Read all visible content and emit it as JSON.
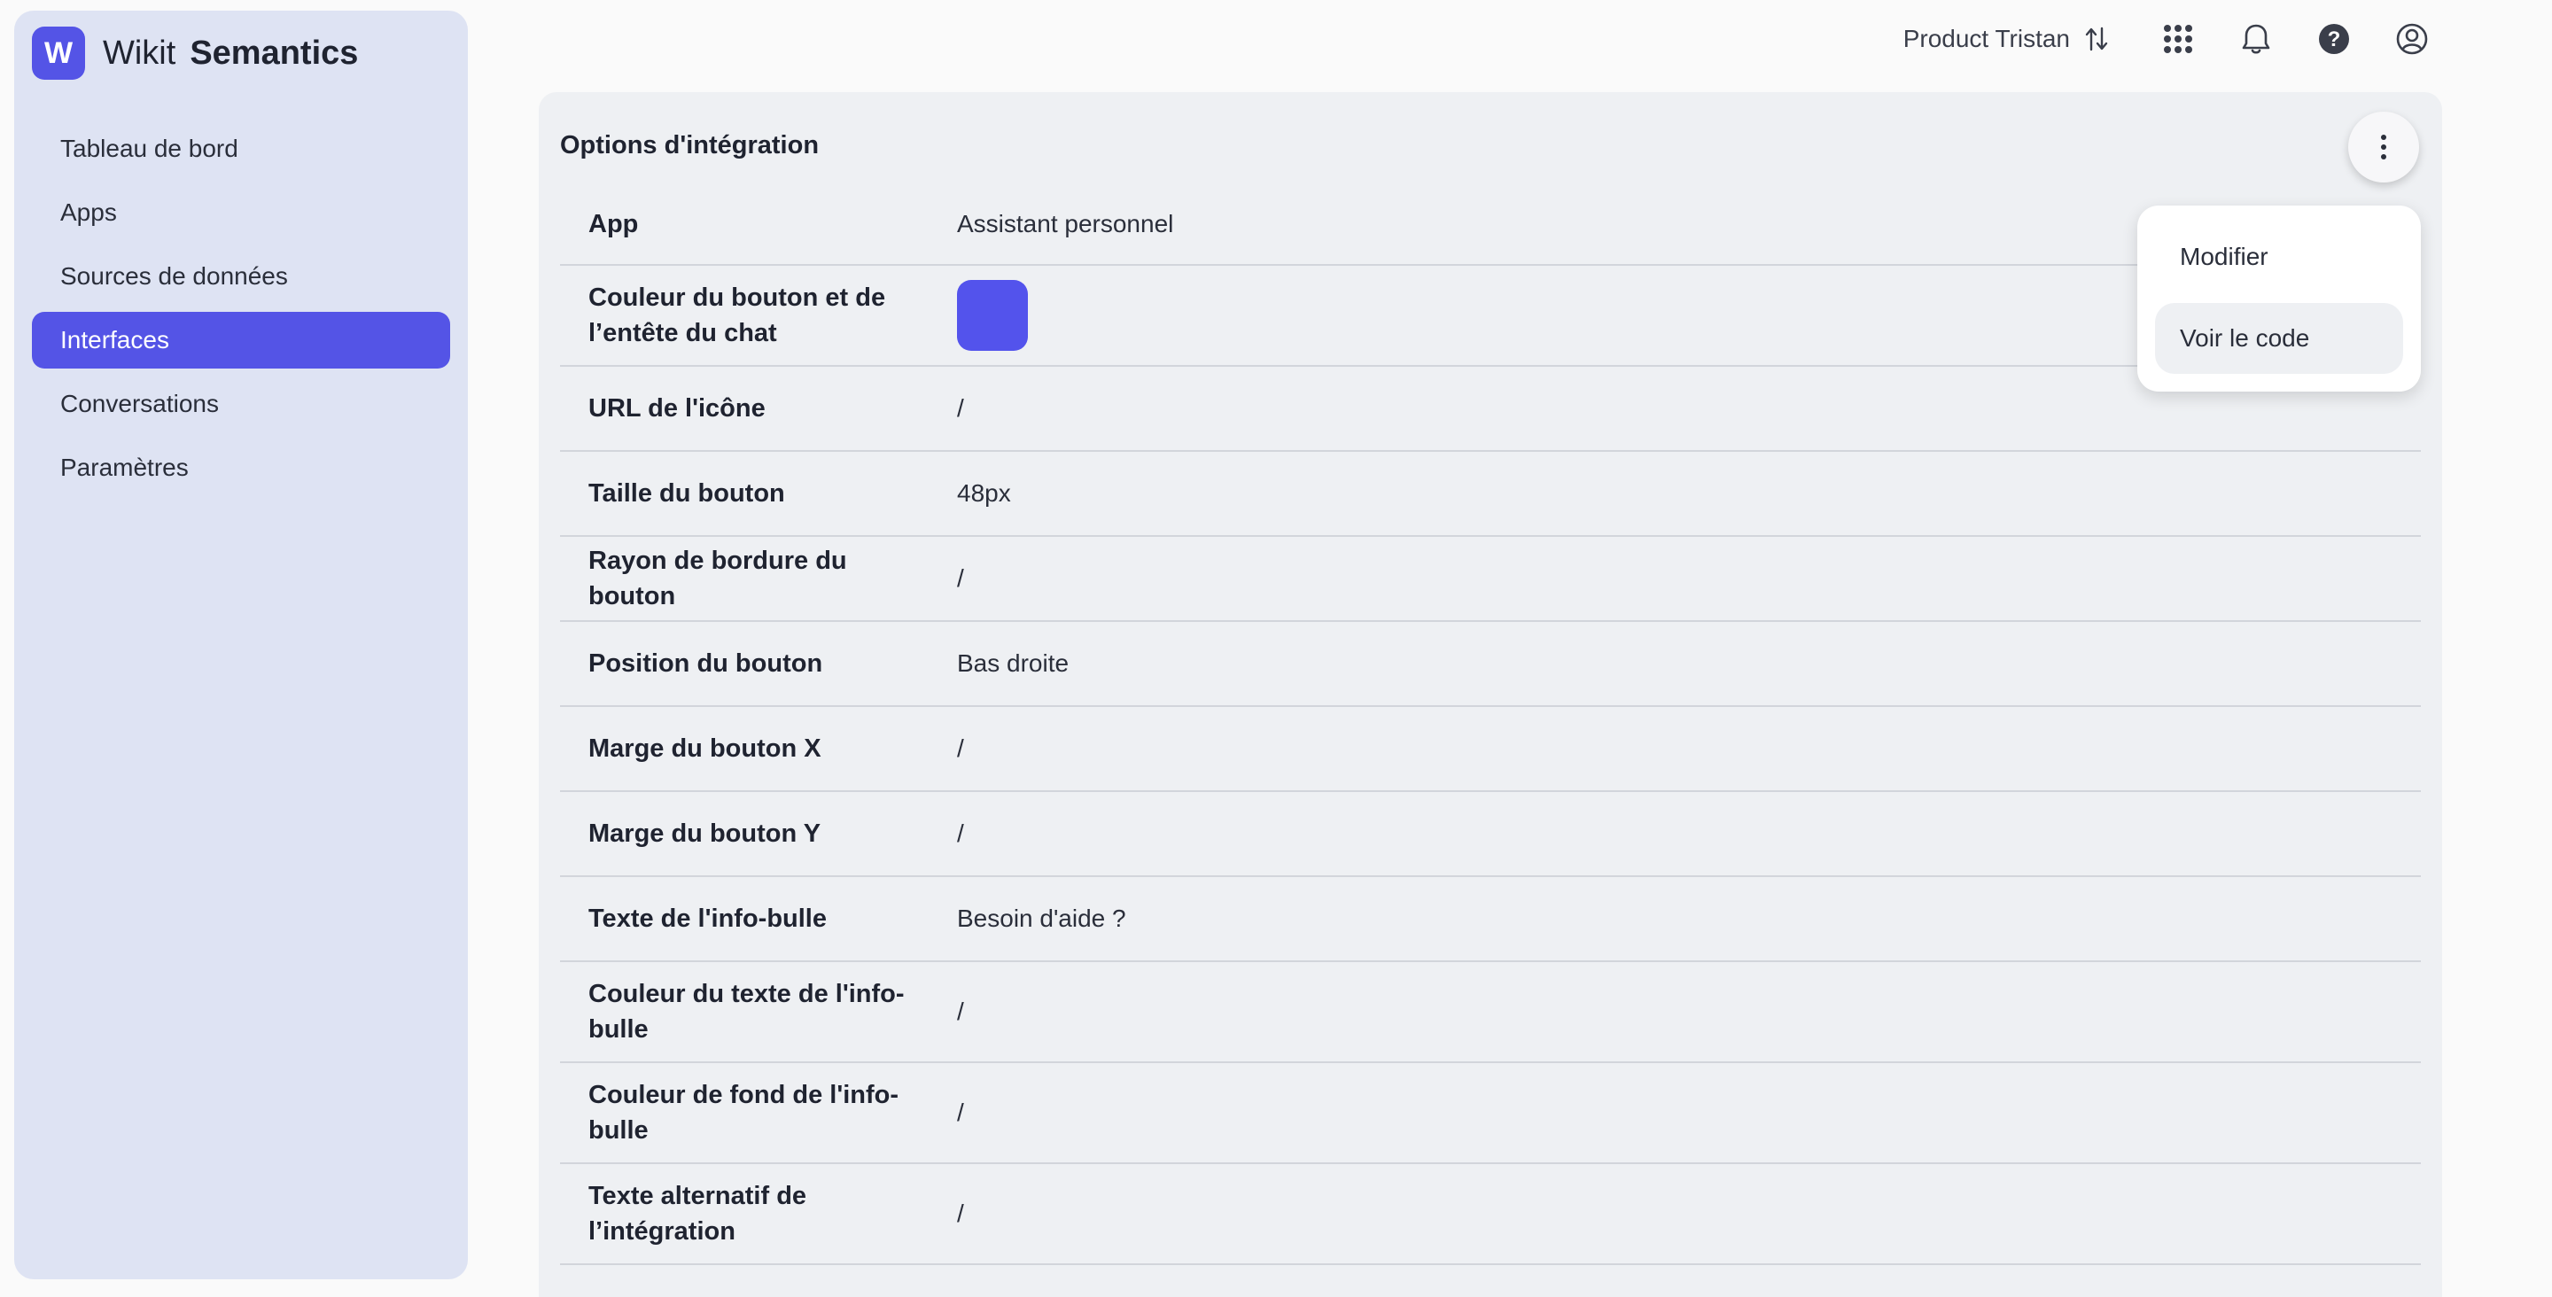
{
  "brand": {
    "logo_letter": "W",
    "name_light": "Wikit",
    "name_bold": "Semantics",
    "accent": "#5454e6"
  },
  "sidebar": {
    "items": [
      {
        "label": "Tableau de bord",
        "active": false
      },
      {
        "label": "Apps",
        "active": false
      },
      {
        "label": "Sources de données",
        "active": false
      },
      {
        "label": "Interfaces",
        "active": true
      },
      {
        "label": "Conversations",
        "active": false
      },
      {
        "label": "Paramètres",
        "active": false
      }
    ]
  },
  "topbar": {
    "product": "Product Tristan",
    "icons": [
      "switch-arrows-icon",
      "apps-grid-icon",
      "bell-icon",
      "help-icon",
      "user-account-icon"
    ]
  },
  "card": {
    "title": "Options d'intégration",
    "rows": [
      {
        "label": "App",
        "value": "Assistant personnel"
      },
      {
        "label": "Couleur du bouton et de l’entête du chat",
        "value": "",
        "swatch": "#5353ec"
      },
      {
        "label": "URL de l'icône",
        "value": "/"
      },
      {
        "label": "Taille du bouton",
        "value": "48px"
      },
      {
        "label": "Rayon de bordure du bouton",
        "value": "/"
      },
      {
        "label": "Position du bouton",
        "value": "Bas droite"
      },
      {
        "label": "Marge du bouton X",
        "value": "/"
      },
      {
        "label": "Marge du bouton Y",
        "value": "/"
      },
      {
        "label": "Texte de l'info-bulle",
        "value": "Besoin d'aide ?"
      },
      {
        "label": "Couleur du texte de l'info-bulle",
        "value": "/"
      },
      {
        "label": "Couleur de fond de l'info-bulle",
        "value": "/"
      },
      {
        "label": "Texte alternatif de l’intégration",
        "value": "/"
      }
    ]
  },
  "menu": {
    "items": [
      {
        "label": "Modifier"
      },
      {
        "label": "Voir le code"
      }
    ]
  }
}
